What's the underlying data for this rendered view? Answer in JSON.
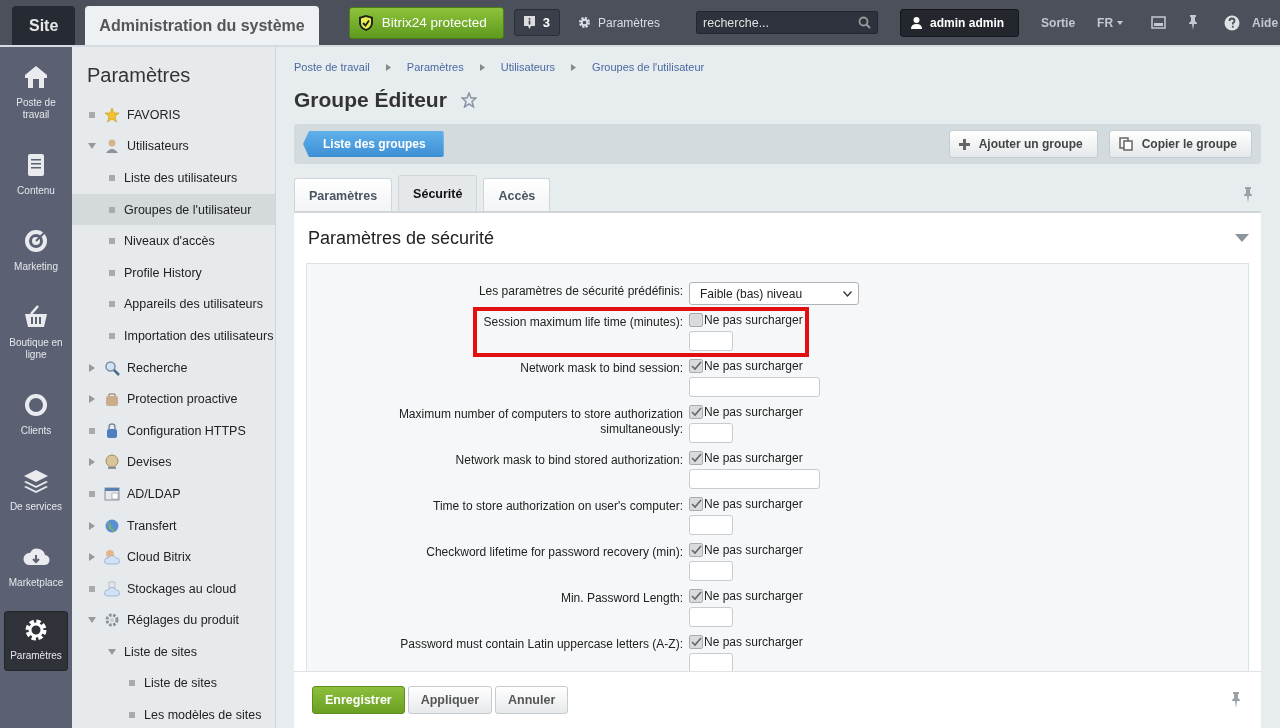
{
  "top_bar": {
    "site_tab": "Site",
    "admin_tab": "Administration du système",
    "protected_badge": "Bitrix24 protected",
    "notifications": "3",
    "settings_link": "Paramètres",
    "search": {
      "placeholder": "recherche..."
    },
    "user": "admin admin",
    "logout": "Sortie",
    "language": "FR",
    "help": "Aide"
  },
  "rail": {
    "items": [
      {
        "label": "Poste de travail",
        "selected": false
      },
      {
        "label": "Contenu",
        "selected": false
      },
      {
        "label": "Marketing",
        "selected": false
      },
      {
        "label": "Boutique en ligne",
        "selected": false
      },
      {
        "label": "Clients",
        "selected": false
      },
      {
        "label": "De services",
        "selected": false
      },
      {
        "label": "Marketplace",
        "selected": false
      },
      {
        "label": "Paramètres",
        "selected": true
      }
    ]
  },
  "sidebar": {
    "title": "Paramètres",
    "items": [
      {
        "label": "FAVORIS",
        "selected": false
      },
      {
        "label": "Utilisateurs",
        "selected": false,
        "expanded": true,
        "children": [
          {
            "label": "Liste des utilisateurs",
            "selected": false
          },
          {
            "label": "Groupes de l'utilisateur",
            "selected": true
          },
          {
            "label": "Niveaux d'accès",
            "selected": false
          },
          {
            "label": "Profile History",
            "selected": false
          },
          {
            "label": "Appareils des utilisateurs",
            "selected": false
          },
          {
            "label": "Importation des utilisateurs",
            "selected": false
          }
        ]
      },
      {
        "label": "Recherche",
        "selected": false,
        "expanded": false
      },
      {
        "label": "Protection proactive",
        "selected": false,
        "expanded": false
      },
      {
        "label": "Configuration HTTPS",
        "selected": false
      },
      {
        "label": "Devises",
        "selected": false,
        "expanded": false
      },
      {
        "label": "AD/LDAP",
        "selected": false
      },
      {
        "label": "Transfert",
        "selected": false,
        "expanded": false
      },
      {
        "label": "Cloud Bitrix",
        "selected": false,
        "expanded": false
      },
      {
        "label": "Stockages au cloud",
        "selected": false
      },
      {
        "label": "Réglages du produit",
        "selected": false,
        "expanded": true,
        "children": [
          {
            "label": "Liste de sites",
            "selected": false,
            "expanded": true,
            "children": [
              {
                "label": "Liste de sites",
                "selected": false
              },
              {
                "label": "Les modèles de sites",
                "selected": false
              }
            ]
          }
        ]
      }
    ]
  },
  "breadcrumbs": [
    "Poste de travail",
    "Paramètres",
    "Utilisateurs",
    "Groupes de l'utilisateur"
  ],
  "page_title": "Groupe Éditeur",
  "toolbar": {
    "back_button": "Liste des groupes",
    "buttons": [
      "Ajouter un groupe",
      "Copier le groupe"
    ]
  },
  "tabs": [
    {
      "label": "Paramètres",
      "selected": false
    },
    {
      "label": "Sécurité",
      "selected": true
    },
    {
      "label": "Accès",
      "selected": false
    }
  ],
  "section_title": "Paramètres de sécurité",
  "preset": {
    "label": "Les paramètres de sécurité prédéfinis:",
    "value": "Faible (bas) niveau"
  },
  "rows": [
    {
      "label": "Session maximum life time (minutes):",
      "override": "Ne pas surcharger",
      "checked": false,
      "kind": "short",
      "highlighted": true
    },
    {
      "label": "Network mask to bind session:",
      "override": "Ne pas surcharger",
      "checked": true,
      "kind": "wide",
      "highlighted": false
    },
    {
      "label": "Maximum number of computers to store authorization simultaneously:",
      "override": "Ne pas surcharger",
      "checked": true,
      "kind": "short",
      "highlighted": false
    },
    {
      "label": "Network mask to bind stored authorization:",
      "override": "Ne pas surcharger",
      "checked": true,
      "kind": "wide",
      "highlighted": false
    },
    {
      "label": "Time to store authorization on user's computer:",
      "override": "Ne pas surcharger",
      "checked": true,
      "kind": "short",
      "highlighted": false
    },
    {
      "label": "Checkword lifetime for password recovery (min):",
      "override": "Ne pas surcharger",
      "checked": true,
      "kind": "short",
      "highlighted": false
    },
    {
      "label": "Min. Password Length:",
      "override": "Ne pas surcharger",
      "checked": true,
      "kind": "short",
      "highlighted": false
    },
    {
      "label": "Password must contain Latin uppercase letters (A-Z):",
      "override": "Ne pas surcharger",
      "checked": true,
      "kind": "short",
      "highlighted": false
    }
  ],
  "footer": {
    "buttons": [
      {
        "label": "Enregistrer",
        "kind": "primary"
      },
      {
        "label": "Appliquer",
        "kind": "default"
      },
      {
        "label": "Annuler",
        "kind": "default"
      }
    ]
  }
}
